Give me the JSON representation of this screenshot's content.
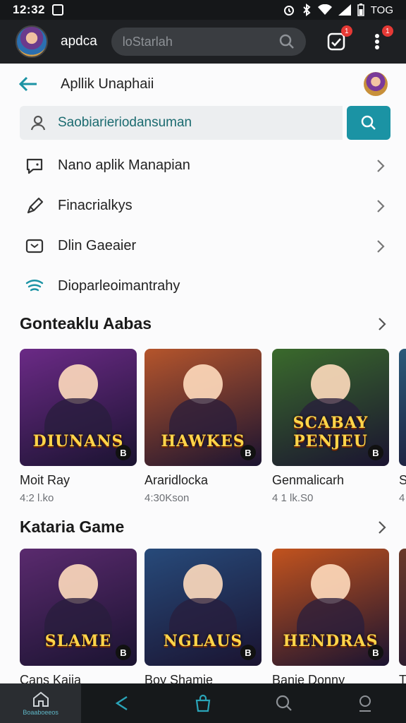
{
  "status_bar": {
    "time": "12:32",
    "battery": "TOG"
  },
  "header": {
    "app_name": "apdca",
    "search_placeholder": "loStarlah",
    "inbox_badge": "1",
    "more_badge": "1"
  },
  "page": {
    "title": "Apllik Unaphaii",
    "search_value": "Saobiarieriodansuman"
  },
  "menu": [
    {
      "label": "Nano aplik Manapian",
      "icon": "chat-icon",
      "chevron": true
    },
    {
      "label": "Finacrialkys",
      "icon": "pencil-icon",
      "chevron": true
    },
    {
      "label": "Dlin Gaeaier",
      "icon": "message-icon",
      "chevron": true
    },
    {
      "label": "Dioparleoimantrahy",
      "icon": "wifi-icon",
      "chevron": false
    }
  ],
  "sections": [
    {
      "title": "Gonteaklu Aabas",
      "cards": [
        {
          "title": "Moit Ray",
          "sub": "4:2 l.ko",
          "logo": "DIUNANS",
          "bg": "#6b2a86"
        },
        {
          "title": "Araridlocka",
          "sub": "4:30Kson",
          "logo": "HAWKES",
          "bg": "#b5552c"
        },
        {
          "title": "Genmalicarh",
          "sub": "4 1 lk.S0",
          "logo": "SCABAY PENJEU",
          "bg": "#3a6a2c"
        },
        {
          "title": "S",
          "sub": "4",
          "logo": "",
          "bg": "#2c5a7a"
        }
      ]
    },
    {
      "title": "Kataria Game",
      "cards": [
        {
          "title": "Cans Kaiia",
          "sub": "",
          "logo": "SLAME",
          "bg": "#5a2a6e"
        },
        {
          "title": "Boy Shamie",
          "sub": "",
          "logo": "NGLAUS",
          "bg": "#274a7a"
        },
        {
          "title": "Banie Donny",
          "sub": "",
          "logo": "HENDRAS",
          "bg": "#c2531e"
        },
        {
          "title": "T",
          "sub": "",
          "logo": "",
          "bg": "#6a3a2a"
        }
      ]
    }
  ],
  "bottom_nav": {
    "home_label": "Boaaboeeos"
  }
}
